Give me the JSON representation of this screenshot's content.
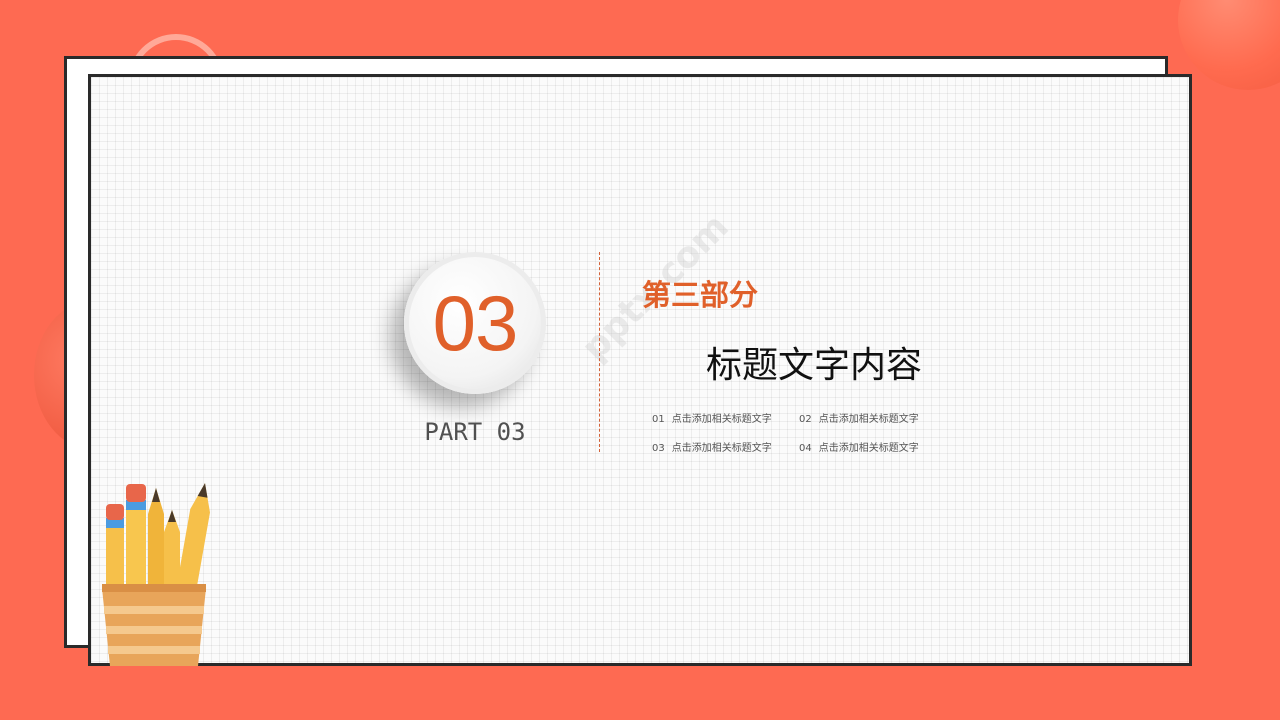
{
  "slide": {
    "number": "03",
    "part_label": "PART 03",
    "section_title": "第三部分",
    "main_title": "标题文字内容",
    "items": [
      {
        "num": "01",
        "text": "点击添加相关标题文字"
      },
      {
        "num": "02",
        "text": "点击添加相关标题文字"
      },
      {
        "num": "03",
        "text": "点击添加相关标题文字"
      },
      {
        "num": "04",
        "text": "点击添加相关标题文字"
      }
    ],
    "watermark": "pptx.com"
  },
  "colors": {
    "background": "#fe6a52",
    "accent": "#e0602a",
    "sheet": "#fbfbfb",
    "border": "#2a2a2a"
  },
  "icons": {
    "pencil_cup": "pencil-cup-icon"
  }
}
